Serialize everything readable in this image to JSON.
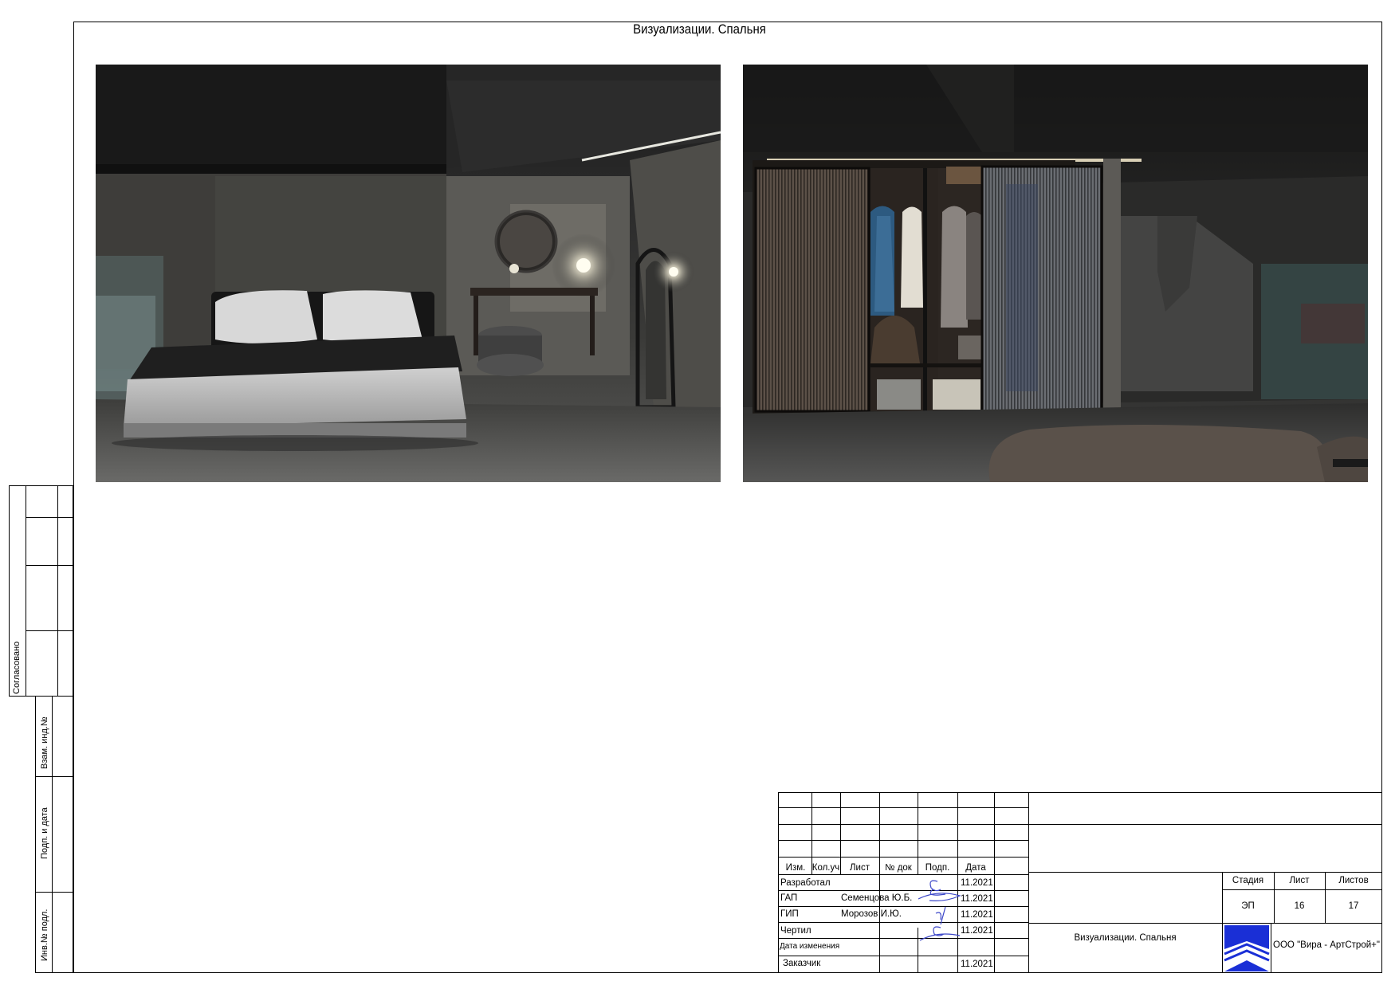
{
  "sheet": {
    "title": "Визуализации. Спальня"
  },
  "renders": [
    {
      "name": "bedroom"
    },
    {
      "name": "wardrobe"
    }
  ],
  "side_stamp": {
    "agreed": "Согласовано",
    "exchange_inv": "Взам. инд.№",
    "sign_date": "Подп. и дата",
    "inv_orig": "Инв.№ подл."
  },
  "title_block": {
    "headers": {
      "izm": "Изм.",
      "kol_uch": "Кол.уч",
      "list": "Лист",
      "doc_no": "№ док",
      "podp": "Подп.",
      "date": "Дата"
    },
    "rows": [
      {
        "role": "Разработал",
        "name": "",
        "date": "11.2021"
      },
      {
        "role": "ГАП",
        "name": "Семенцова Ю.Б.",
        "date": "11.2021"
      },
      {
        "role": "ГИП",
        "name": "Морозов И.Ю.",
        "date": "11.2021"
      },
      {
        "role": "Чертил",
        "name": "",
        "date": "11.2021"
      },
      {
        "role": "Дата изменения",
        "name": "",
        "date": ""
      },
      {
        "role": "Заказчик",
        "name": "",
        "date": "11.2021"
      }
    ],
    "sheet_name": "Визуализации. Спальня",
    "stage_label": "Стадия",
    "sheet_label": "Лист",
    "sheets_label": "Листов",
    "stage": "ЭП",
    "sheet_no": "16",
    "sheets_total": "17",
    "company": "ООО \"Вира - АртСтрой+\"",
    "colors": {
      "logo": "#1a2fd6",
      "signature": "#3b46c8"
    }
  }
}
